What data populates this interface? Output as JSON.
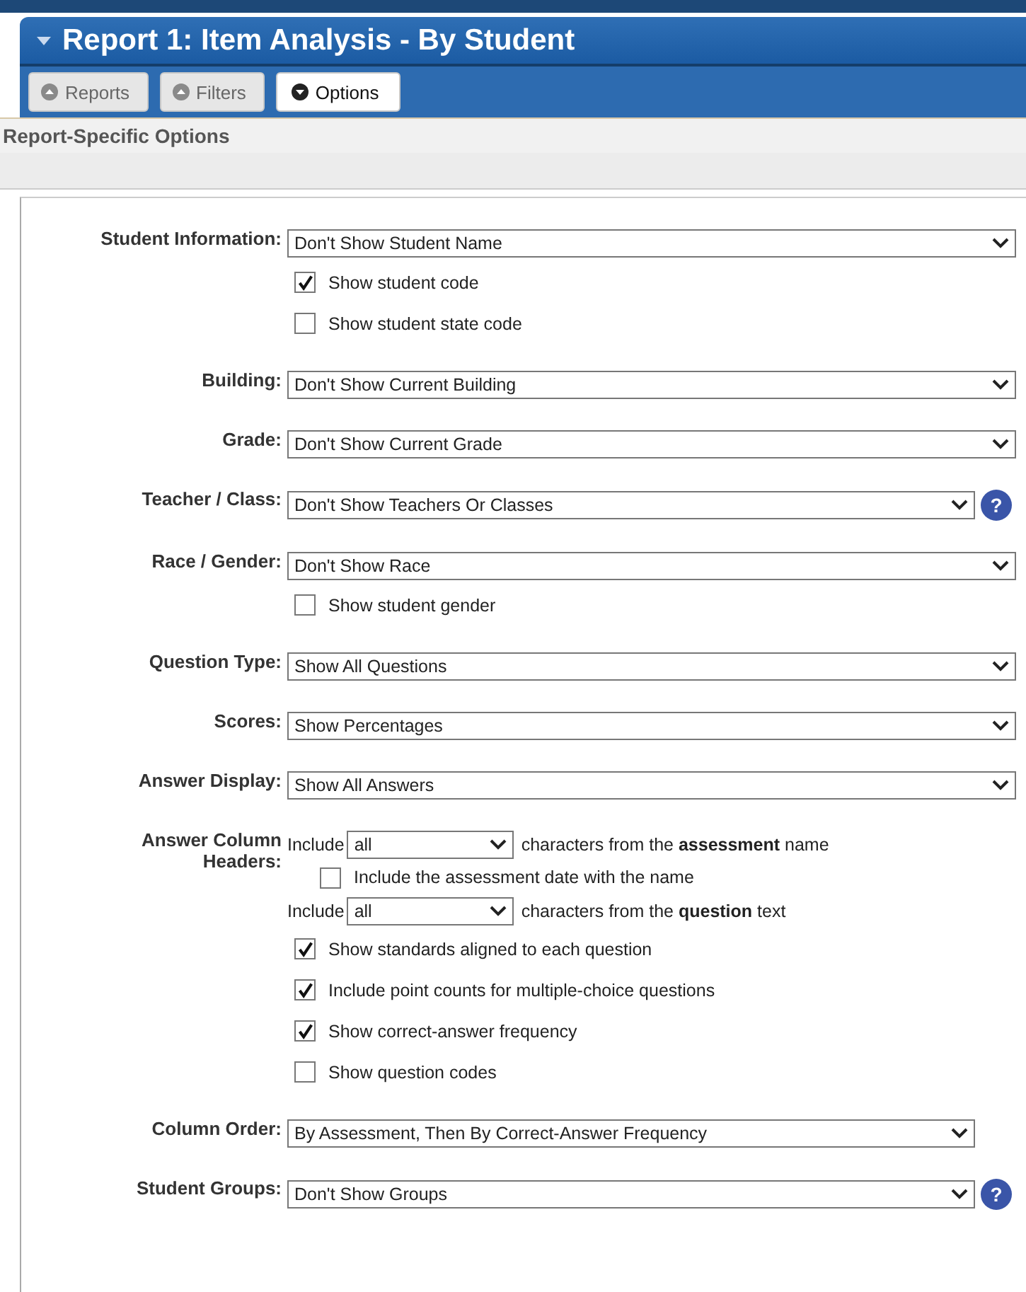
{
  "title": "Report 1: Item Analysis - By Student",
  "tabs": [
    {
      "label": "Reports",
      "selected": false
    },
    {
      "label": "Filters",
      "selected": false
    },
    {
      "label": "Options",
      "selected": true
    }
  ],
  "section_title": "Report-Specific Options",
  "rows": [
    {
      "label": "Student Information:",
      "items": [
        {
          "kind": "select",
          "value": "Don't Show Student Name"
        },
        {
          "kind": "checkbox",
          "label": "Show student code",
          "checked": true
        },
        {
          "kind": "checkbox",
          "label": "Show student state code",
          "checked": false
        }
      ]
    },
    {
      "label": "Building:",
      "items": [
        {
          "kind": "select",
          "value": "Don't Show Current Building"
        }
      ]
    },
    {
      "label": "Grade:",
      "items": [
        {
          "kind": "select",
          "value": "Don't Show Current Grade"
        }
      ]
    },
    {
      "label": "Teacher / Class:",
      "help": "?",
      "items": [
        {
          "kind": "select",
          "value": "Don't Show Teachers Or Classes"
        }
      ]
    },
    {
      "label": "Race / Gender:",
      "items": [
        {
          "kind": "select",
          "value": "Don't Show Race"
        },
        {
          "kind": "checkbox",
          "label": "Show student gender",
          "checked": false
        }
      ]
    },
    {
      "label": "Question Type:",
      "items": [
        {
          "kind": "select",
          "value": "Show All Questions"
        }
      ]
    },
    {
      "label": "Scores:",
      "items": [
        {
          "kind": "select",
          "value": "Show Percentages"
        }
      ]
    },
    {
      "label": "Answer Display:",
      "items": [
        {
          "kind": "select",
          "value": "Show All Answers"
        }
      ]
    },
    {
      "label": "Answer Column Headers:",
      "items": [
        {
          "kind": "include",
          "prefix": "Include",
          "value": "all",
          "suffix": "characters from the **assessment** name"
        },
        {
          "kind": "indented-checkbox",
          "label": "Include the assessment date with the name",
          "checked": false
        },
        {
          "kind": "include",
          "prefix": "Include",
          "value": "all",
          "suffix": "characters from the **question** text"
        },
        {
          "kind": "checkbox",
          "label": "Show standards aligned to each question",
          "checked": true
        },
        {
          "kind": "checkbox",
          "label": "Include point counts for multiple-choice questions",
          "checked": true
        },
        {
          "kind": "checkbox",
          "label": "Show correct-answer frequency",
          "checked": true
        },
        {
          "kind": "checkbox",
          "label": "Show question codes",
          "checked": false
        }
      ]
    },
    {
      "label": "Column Order:",
      "short": true,
      "items": [
        {
          "kind": "select",
          "value": "By Assessment, Then By Correct-Answer Frequency"
        }
      ]
    },
    {
      "label": "Student Groups:",
      "help": "?",
      "items": [
        {
          "kind": "select",
          "value": "Don't Show Groups"
        }
      ]
    }
  ]
}
